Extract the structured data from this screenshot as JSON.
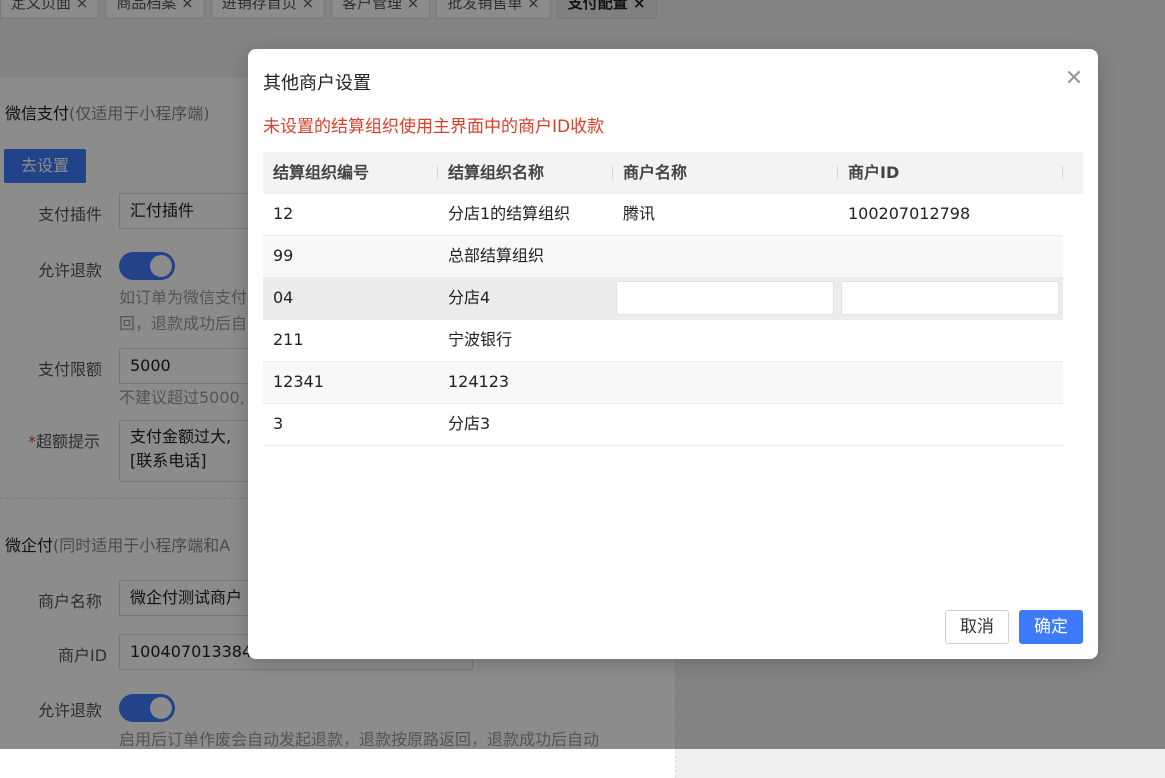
{
  "tabs": [
    {
      "label": "定义页面 ×"
    },
    {
      "label": "商品档案 ×"
    },
    {
      "label": "进销存首页 ×"
    },
    {
      "label": "客户管理 ×"
    },
    {
      "label": "批发销售单 ×"
    },
    {
      "label": "支付配置 ×"
    }
  ],
  "wechat": {
    "title": "微信支付",
    "title_note": "(仅适用于小程序端)",
    "setup_button": "去设置",
    "plugin_label": "支付插件",
    "plugin_value": "汇付插件",
    "refund_label": "允许退款",
    "refund_help_1": "如订单为微信支付",
    "refund_help_2": "回，退款成功后自",
    "limit_label": "支付限额",
    "limit_value": "5000",
    "limit_help": "不建议超过5000,",
    "overlimit_star": "*",
    "overlimit_label": "超额提示",
    "overlimit_value_1": "支付金额过大,",
    "overlimit_value_2": "[联系电话]"
  },
  "weiqi": {
    "title": "微企付",
    "title_note": "(同时适用于小程序端和A",
    "merchant_name_label": "商户名称",
    "merchant_name_value": "微企付测试商户",
    "merchant_id_label": "商户ID",
    "merchant_id_value": "100407013384",
    "refund_label": "允许退款",
    "refund_help": "启用后订单作废会自动发起退款，退款按原路返回，退款成功后自动"
  },
  "modal": {
    "title": "其他商户设置",
    "close_icon": "close-icon",
    "warning": "未设置的结算组织使用主界面中的商户ID收款",
    "columns": [
      "结算组织编号",
      "结算组织名称",
      "商户名称",
      "商户ID"
    ],
    "rows": [
      {
        "code": "12",
        "name": "分店1的结算组织",
        "merchant": "腾讯",
        "merchant_id": "100207012798"
      },
      {
        "code": "99",
        "name": "总部结算组织",
        "merchant": "",
        "merchant_id": ""
      },
      {
        "code": "04",
        "name": "分店4",
        "merchant": "",
        "merchant_id": ""
      },
      {
        "code": "211",
        "name": "宁波银行",
        "merchant": "",
        "merchant_id": ""
      },
      {
        "code": "12341",
        "name": "124123",
        "merchant": "",
        "merchant_id": ""
      },
      {
        "code": "3",
        "name": "分店3",
        "merchant": "",
        "merchant_id": ""
      }
    ],
    "cancel_label": "取消",
    "confirm_label": "确定"
  },
  "colors": {
    "primary": "#3e7bfa",
    "warning": "#d9402b"
  }
}
